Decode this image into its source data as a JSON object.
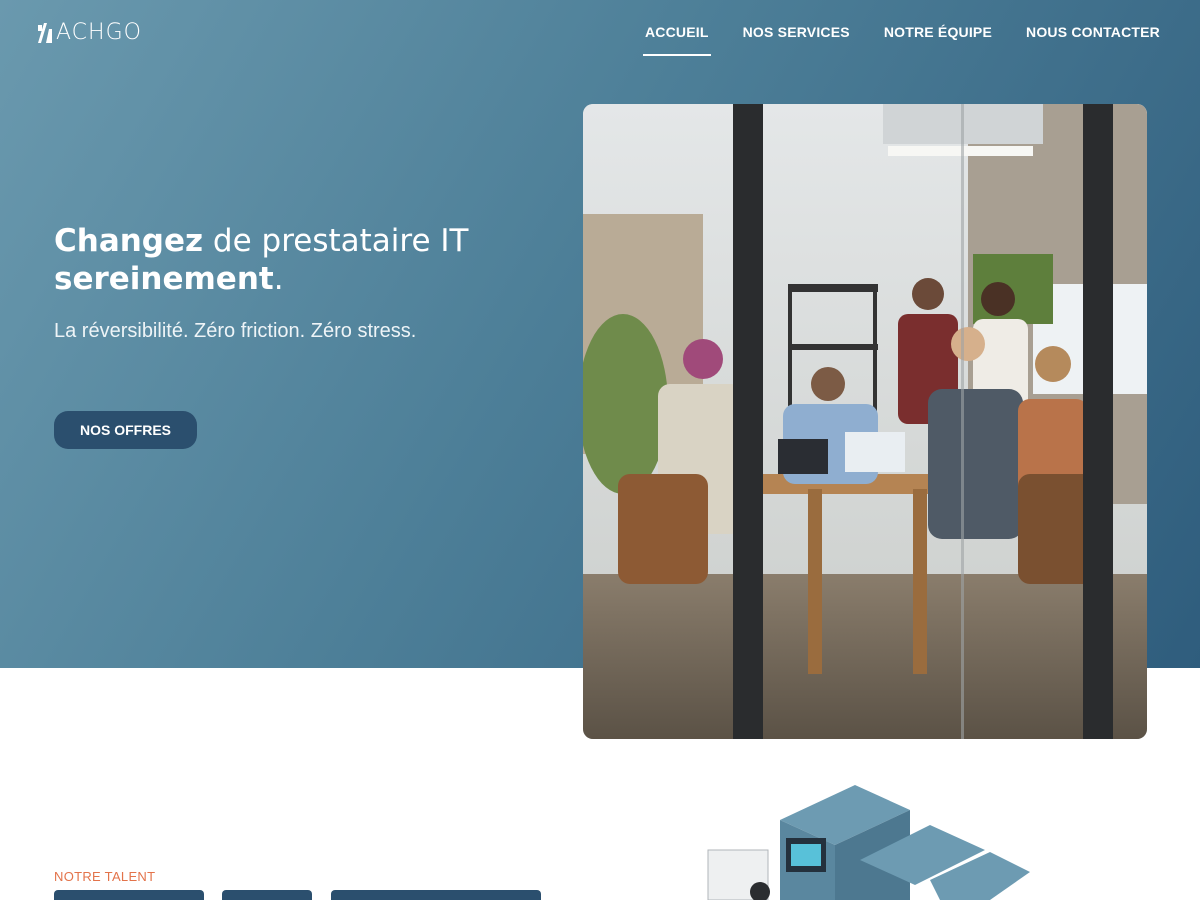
{
  "header": {
    "logo_text": "ACHGO",
    "nav": [
      {
        "label": "ACCUEIL",
        "active": true
      },
      {
        "label": "NOS SERVICES",
        "active": false
      },
      {
        "label": "NOTRE ÉQUIPE",
        "active": false
      },
      {
        "label": "NOUS CONTACTER",
        "active": false
      }
    ]
  },
  "hero": {
    "headline_bold_1": "Changez",
    "headline_rest_1": " de prestataire IT",
    "headline_bold_2": "sereinement",
    "headline_rest_2": ".",
    "tagline": "La réversibilité. Zéro friction. Zéro stress.",
    "cta_label": "NOS OFFRES",
    "photo_alt": "Équipe en réunion applaudissant dans une salle vitrée"
  },
  "talent": {
    "label": "NOTRE TALENT"
  },
  "colors": {
    "hero_start": "#6a99ae",
    "hero_end": "#2f5d7d",
    "button": "#2b4f6e",
    "accent": "#e3734a",
    "server_panel": "#5c8ea6"
  },
  "icons": {
    "logo": "achgo-logo-icon",
    "illustration": "server-rack-illustration"
  }
}
